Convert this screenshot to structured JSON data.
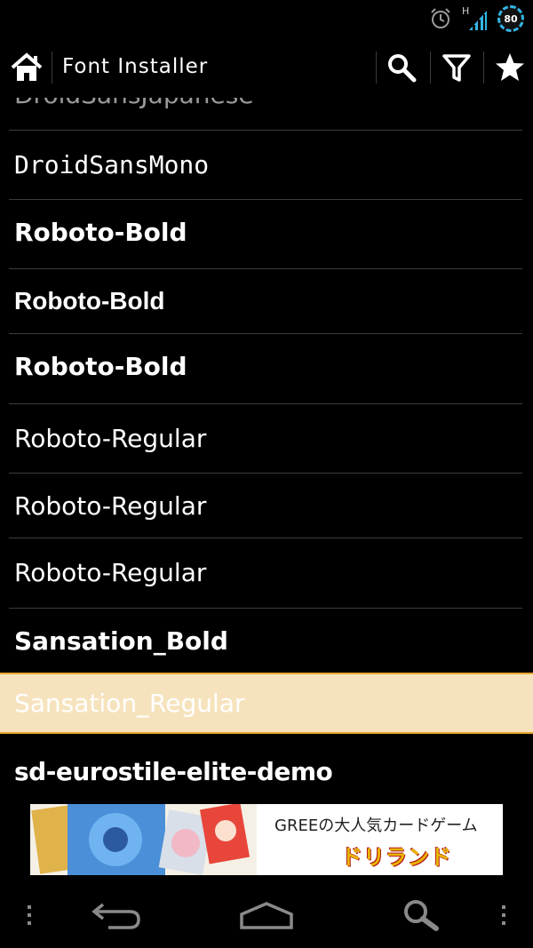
{
  "status_bar": {
    "network_type": "H",
    "battery_level": "80",
    "icons": [
      "alarm-icon",
      "signal-icon",
      "battery-icon"
    ]
  },
  "action_bar": {
    "title": "Font Installer",
    "icons": [
      "home-icon",
      "search-icon",
      "filter-icon",
      "star-icon"
    ]
  },
  "font_list": {
    "partial_item": "DroidSansJapanese",
    "items": [
      {
        "label": "DroidSansMono",
        "style": "mono"
      },
      {
        "label": "Roboto-Bold",
        "style": "bold"
      },
      {
        "label": "Roboto-Bold",
        "style": "bold"
      },
      {
        "label": "Roboto-Bold",
        "style": "bold"
      },
      {
        "label": "Roboto-Regular",
        "style": "regular"
      },
      {
        "label": "Roboto-Regular",
        "style": "regular"
      },
      {
        "label": "Roboto-Regular",
        "style": "regular"
      },
      {
        "label": "Sansation_Bold",
        "style": "bold"
      },
      {
        "label": "Sansation_Regular",
        "style": "regular",
        "selected": true
      },
      {
        "label": "sd-eurostile-elite-demo",
        "style": "bold"
      }
    ],
    "selected_color": "#f6e3bd",
    "selected_border": "#e8a62e"
  },
  "ad_banner": {
    "text": "GREEの大人気カードゲーム",
    "logo_text": "ドリランド"
  },
  "nav_bar": {
    "icons": [
      "menu-dots-icon",
      "back-icon",
      "home-icon",
      "search-icon",
      "overflow-icon"
    ]
  }
}
